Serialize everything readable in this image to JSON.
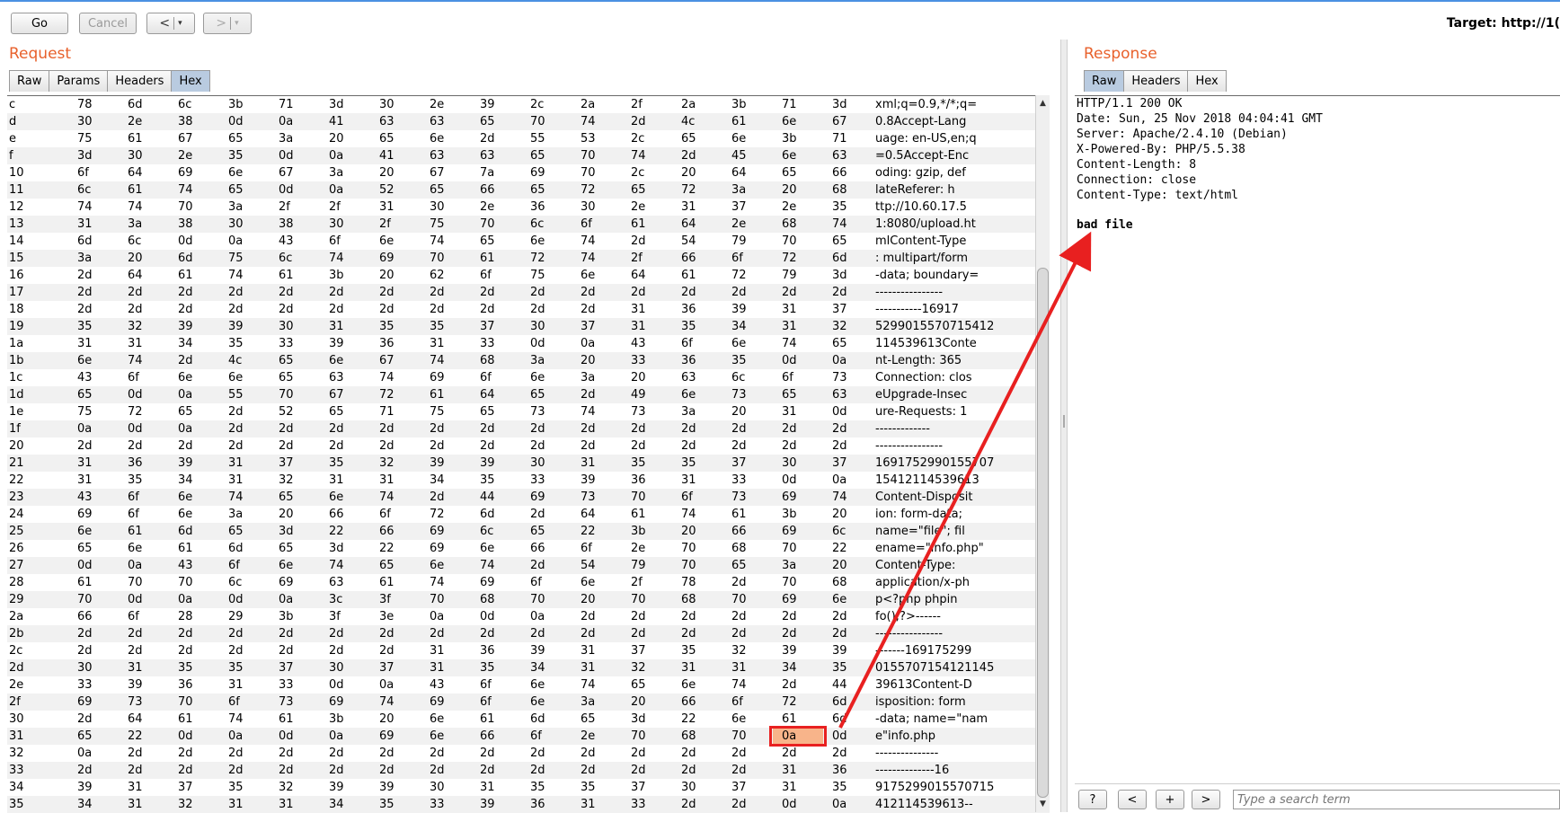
{
  "toolbar": {
    "go_label": "Go",
    "cancel_label": "Cancel",
    "back_label": "<",
    "forward_label": ">",
    "dropdown_glyph": "▾",
    "target_label": "Target: http://1("
  },
  "request": {
    "title": "Request",
    "tabs": [
      "Raw",
      "Params",
      "Headers",
      "Hex"
    ],
    "active_tab": "Hex",
    "hex_rows": [
      {
        "idx": "c",
        "bytes": [
          "78",
          "6d",
          "6c",
          "3b",
          "71",
          "3d",
          "30",
          "2e",
          "39",
          "2c",
          "2a",
          "2f",
          "2a",
          "3b",
          "71",
          "3d"
        ],
        "ascii": "xml;q=0.9,*/*;q="
      },
      {
        "idx": "d",
        "bytes": [
          "30",
          "2e",
          "38",
          "0d",
          "0a",
          "41",
          "63",
          "63",
          "65",
          "70",
          "74",
          "2d",
          "4c",
          "61",
          "6e",
          "67"
        ],
        "ascii": "0.8Accept-Lang"
      },
      {
        "idx": "e",
        "bytes": [
          "75",
          "61",
          "67",
          "65",
          "3a",
          "20",
          "65",
          "6e",
          "2d",
          "55",
          "53",
          "2c",
          "65",
          "6e",
          "3b",
          "71"
        ],
        "ascii": "uage: en-US,en;q"
      },
      {
        "idx": "f",
        "bytes": [
          "3d",
          "30",
          "2e",
          "35",
          "0d",
          "0a",
          "41",
          "63",
          "63",
          "65",
          "70",
          "74",
          "2d",
          "45",
          "6e",
          "63"
        ],
        "ascii": "=0.5Accept-Enc"
      },
      {
        "idx": "10",
        "bytes": [
          "6f",
          "64",
          "69",
          "6e",
          "67",
          "3a",
          "20",
          "67",
          "7a",
          "69",
          "70",
          "2c",
          "20",
          "64",
          "65",
          "66"
        ],
        "ascii": "oding: gzip, def"
      },
      {
        "idx": "11",
        "bytes": [
          "6c",
          "61",
          "74",
          "65",
          "0d",
          "0a",
          "52",
          "65",
          "66",
          "65",
          "72",
          "65",
          "72",
          "3a",
          "20",
          "68"
        ],
        "ascii": "lateReferer: h"
      },
      {
        "idx": "12",
        "bytes": [
          "74",
          "74",
          "70",
          "3a",
          "2f",
          "2f",
          "31",
          "30",
          "2e",
          "36",
          "30",
          "2e",
          "31",
          "37",
          "2e",
          "35"
        ],
        "ascii": "ttp://10.60.17.5"
      },
      {
        "idx": "13",
        "bytes": [
          "31",
          "3a",
          "38",
          "30",
          "38",
          "30",
          "2f",
          "75",
          "70",
          "6c",
          "6f",
          "61",
          "64",
          "2e",
          "68",
          "74"
        ],
        "ascii": "1:8080/upload.ht"
      },
      {
        "idx": "14",
        "bytes": [
          "6d",
          "6c",
          "0d",
          "0a",
          "43",
          "6f",
          "6e",
          "74",
          "65",
          "6e",
          "74",
          "2d",
          "54",
          "79",
          "70",
          "65"
        ],
        "ascii": "mlContent-Type"
      },
      {
        "idx": "15",
        "bytes": [
          "3a",
          "20",
          "6d",
          "75",
          "6c",
          "74",
          "69",
          "70",
          "61",
          "72",
          "74",
          "2f",
          "66",
          "6f",
          "72",
          "6d"
        ],
        "ascii": ": multipart/form"
      },
      {
        "idx": "16",
        "bytes": [
          "2d",
          "64",
          "61",
          "74",
          "61",
          "3b",
          "20",
          "62",
          "6f",
          "75",
          "6e",
          "64",
          "61",
          "72",
          "79",
          "3d"
        ],
        "ascii": "-data; boundary="
      },
      {
        "idx": "17",
        "bytes": [
          "2d",
          "2d",
          "2d",
          "2d",
          "2d",
          "2d",
          "2d",
          "2d",
          "2d",
          "2d",
          "2d",
          "2d",
          "2d",
          "2d",
          "2d",
          "2d"
        ],
        "ascii": "----------------"
      },
      {
        "idx": "18",
        "bytes": [
          "2d",
          "2d",
          "2d",
          "2d",
          "2d",
          "2d",
          "2d",
          "2d",
          "2d",
          "2d",
          "2d",
          "31",
          "36",
          "39",
          "31",
          "37"
        ],
        "ascii": "-----------16917"
      },
      {
        "idx": "19",
        "bytes": [
          "35",
          "32",
          "39",
          "39",
          "30",
          "31",
          "35",
          "35",
          "37",
          "30",
          "37",
          "31",
          "35",
          "34",
          "31",
          "32"
        ],
        "ascii": "5299015570715412"
      },
      {
        "idx": "1a",
        "bytes": [
          "31",
          "31",
          "34",
          "35",
          "33",
          "39",
          "36",
          "31",
          "33",
          "0d",
          "0a",
          "43",
          "6f",
          "6e",
          "74",
          "65"
        ],
        "ascii": "114539613Conte"
      },
      {
        "idx": "1b",
        "bytes": [
          "6e",
          "74",
          "2d",
          "4c",
          "65",
          "6e",
          "67",
          "74",
          "68",
          "3a",
          "20",
          "33",
          "36",
          "35",
          "0d",
          "0a"
        ],
        "ascii": "nt-Length: 365"
      },
      {
        "idx": "1c",
        "bytes": [
          "43",
          "6f",
          "6e",
          "6e",
          "65",
          "63",
          "74",
          "69",
          "6f",
          "6e",
          "3a",
          "20",
          "63",
          "6c",
          "6f",
          "73"
        ],
        "ascii": "Connection: clos"
      },
      {
        "idx": "1d",
        "bytes": [
          "65",
          "0d",
          "0a",
          "55",
          "70",
          "67",
          "72",
          "61",
          "64",
          "65",
          "2d",
          "49",
          "6e",
          "73",
          "65",
          "63"
        ],
        "ascii": "eUpgrade-Insec"
      },
      {
        "idx": "1e",
        "bytes": [
          "75",
          "72",
          "65",
          "2d",
          "52",
          "65",
          "71",
          "75",
          "65",
          "73",
          "74",
          "73",
          "3a",
          "20",
          "31",
          "0d"
        ],
        "ascii": "ure-Requests: 1"
      },
      {
        "idx": "1f",
        "bytes": [
          "0a",
          "0d",
          "0a",
          "2d",
          "2d",
          "2d",
          "2d",
          "2d",
          "2d",
          "2d",
          "2d",
          "2d",
          "2d",
          "2d",
          "2d",
          "2d"
        ],
        "ascii": "-------------"
      },
      {
        "idx": "20",
        "bytes": [
          "2d",
          "2d",
          "2d",
          "2d",
          "2d",
          "2d",
          "2d",
          "2d",
          "2d",
          "2d",
          "2d",
          "2d",
          "2d",
          "2d",
          "2d",
          "2d"
        ],
        "ascii": "----------------"
      },
      {
        "idx": "21",
        "bytes": [
          "31",
          "36",
          "39",
          "31",
          "37",
          "35",
          "32",
          "39",
          "39",
          "30",
          "31",
          "35",
          "35",
          "37",
          "30",
          "37"
        ],
        "ascii": "1691752990155707"
      },
      {
        "idx": "22",
        "bytes": [
          "31",
          "35",
          "34",
          "31",
          "32",
          "31",
          "31",
          "34",
          "35",
          "33",
          "39",
          "36",
          "31",
          "33",
          "0d",
          "0a"
        ],
        "ascii": "15412114539613"
      },
      {
        "idx": "23",
        "bytes": [
          "43",
          "6f",
          "6e",
          "74",
          "65",
          "6e",
          "74",
          "2d",
          "44",
          "69",
          "73",
          "70",
          "6f",
          "73",
          "69",
          "74"
        ],
        "ascii": "Content-Disposit"
      },
      {
        "idx": "24",
        "bytes": [
          "69",
          "6f",
          "6e",
          "3a",
          "20",
          "66",
          "6f",
          "72",
          "6d",
          "2d",
          "64",
          "61",
          "74",
          "61",
          "3b",
          "20"
        ],
        "ascii": "ion: form-data; "
      },
      {
        "idx": "25",
        "bytes": [
          "6e",
          "61",
          "6d",
          "65",
          "3d",
          "22",
          "66",
          "69",
          "6c",
          "65",
          "22",
          "3b",
          "20",
          "66",
          "69",
          "6c"
        ],
        "ascii": "name=\"file\"; fil"
      },
      {
        "idx": "26",
        "bytes": [
          "65",
          "6e",
          "61",
          "6d",
          "65",
          "3d",
          "22",
          "69",
          "6e",
          "66",
          "6f",
          "2e",
          "70",
          "68",
          "70",
          "22"
        ],
        "ascii": "ename=\"info.php\""
      },
      {
        "idx": "27",
        "bytes": [
          "0d",
          "0a",
          "43",
          "6f",
          "6e",
          "74",
          "65",
          "6e",
          "74",
          "2d",
          "54",
          "79",
          "70",
          "65",
          "3a",
          "20"
        ],
        "ascii": "Content-Type: "
      },
      {
        "idx": "28",
        "bytes": [
          "61",
          "70",
          "70",
          "6c",
          "69",
          "63",
          "61",
          "74",
          "69",
          "6f",
          "6e",
          "2f",
          "78",
          "2d",
          "70",
          "68"
        ],
        "ascii": "application/x-ph"
      },
      {
        "idx": "29",
        "bytes": [
          "70",
          "0d",
          "0a",
          "0d",
          "0a",
          "3c",
          "3f",
          "70",
          "68",
          "70",
          "20",
          "70",
          "68",
          "70",
          "69",
          "6e"
        ],
        "ascii": "p<?php phpin"
      },
      {
        "idx": "2a",
        "bytes": [
          "66",
          "6f",
          "28",
          "29",
          "3b",
          "3f",
          "3e",
          "0a",
          "0d",
          "0a",
          "2d",
          "2d",
          "2d",
          "2d",
          "2d",
          "2d"
        ],
        "ascii": "fo();?>------"
      },
      {
        "idx": "2b",
        "bytes": [
          "2d",
          "2d",
          "2d",
          "2d",
          "2d",
          "2d",
          "2d",
          "2d",
          "2d",
          "2d",
          "2d",
          "2d",
          "2d",
          "2d",
          "2d",
          "2d"
        ],
        "ascii": "----------------"
      },
      {
        "idx": "2c",
        "bytes": [
          "2d",
          "2d",
          "2d",
          "2d",
          "2d",
          "2d",
          "2d",
          "31",
          "36",
          "39",
          "31",
          "37",
          "35",
          "32",
          "39",
          "39"
        ],
        "ascii": "-------169175299"
      },
      {
        "idx": "2d",
        "bytes": [
          "30",
          "31",
          "35",
          "35",
          "37",
          "30",
          "37",
          "31",
          "35",
          "34",
          "31",
          "32",
          "31",
          "31",
          "34",
          "35"
        ],
        "ascii": "0155707154121145"
      },
      {
        "idx": "2e",
        "bytes": [
          "33",
          "39",
          "36",
          "31",
          "33",
          "0d",
          "0a",
          "43",
          "6f",
          "6e",
          "74",
          "65",
          "6e",
          "74",
          "2d",
          "44"
        ],
        "ascii": "39613Content-D"
      },
      {
        "idx": "2f",
        "bytes": [
          "69",
          "73",
          "70",
          "6f",
          "73",
          "69",
          "74",
          "69",
          "6f",
          "6e",
          "3a",
          "20",
          "66",
          "6f",
          "72",
          "6d"
        ],
        "ascii": "isposition: form"
      },
      {
        "idx": "30",
        "bytes": [
          "2d",
          "64",
          "61",
          "74",
          "61",
          "3b",
          "20",
          "6e",
          "61",
          "6d",
          "65",
          "3d",
          "22",
          "6e",
          "61",
          "6d"
        ],
        "ascii": "-data; name=\"nam"
      },
      {
        "idx": "31",
        "bytes": [
          "65",
          "22",
          "0d",
          "0a",
          "0d",
          "0a",
          "69",
          "6e",
          "66",
          "6f",
          "2e",
          "70",
          "68",
          "70",
          "0a",
          "0d"
        ],
        "ascii": "e\"info.php"
      },
      {
        "idx": "32",
        "bytes": [
          "0a",
          "2d",
          "2d",
          "2d",
          "2d",
          "2d",
          "2d",
          "2d",
          "2d",
          "2d",
          "2d",
          "2d",
          "2d",
          "2d",
          "2d",
          "2d"
        ],
        "ascii": "---------------"
      },
      {
        "idx": "33",
        "bytes": [
          "2d",
          "2d",
          "2d",
          "2d",
          "2d",
          "2d",
          "2d",
          "2d",
          "2d",
          "2d",
          "2d",
          "2d",
          "2d",
          "2d",
          "31",
          "36"
        ],
        "ascii": "--------------16"
      },
      {
        "idx": "34",
        "bytes": [
          "39",
          "31",
          "37",
          "35",
          "32",
          "39",
          "39",
          "30",
          "31",
          "35",
          "35",
          "37",
          "30",
          "37",
          "31",
          "35"
        ],
        "ascii": "9175299015570715"
      },
      {
        "idx": "35",
        "bytes": [
          "34",
          "31",
          "32",
          "31",
          "31",
          "34",
          "35",
          "33",
          "39",
          "36",
          "31",
          "33",
          "2d",
          "2d",
          "0d",
          "0a"
        ],
        "ascii": "412114539613--"
      }
    ],
    "highlight": {
      "row_idx": "31",
      "byte_value": "0a",
      "color": "#f8b48a",
      "box_color": "#e82020"
    }
  },
  "response": {
    "title": "Response",
    "tabs": [
      "Raw",
      "Headers",
      "Hex"
    ],
    "active_tab": "Raw",
    "lines": [
      "HTTP/1.1 200 OK",
      "Date: Sun, 25 Nov 2018 04:04:41 GMT",
      "Server: Apache/2.4.10 (Debian)",
      "X-Powered-By: PHP/5.5.38",
      "Content-Length: 8",
      "Connection: close",
      "Content-Type: text/html"
    ],
    "body": "bad file"
  },
  "search": {
    "help_label": "?",
    "prev_label": "<",
    "add_label": "+",
    "next_label": ">",
    "placeholder": "Type a search term"
  },
  "colors": {
    "section_title": "#e8612c",
    "active_tab": "#b9cbe0",
    "arrow": "#e82020"
  }
}
